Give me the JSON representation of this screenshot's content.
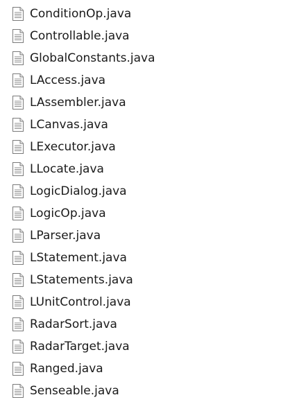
{
  "files": [
    {
      "name": "ConditionOp.java",
      "icon": "document-icon"
    },
    {
      "name": "Controllable.java",
      "icon": "document-icon"
    },
    {
      "name": "GlobalConstants.java",
      "icon": "document-icon"
    },
    {
      "name": "LAccess.java",
      "icon": "document-icon"
    },
    {
      "name": "LAssembler.java",
      "icon": "document-icon"
    },
    {
      "name": "LCanvas.java",
      "icon": "document-icon"
    },
    {
      "name": "LExecutor.java",
      "icon": "document-icon"
    },
    {
      "name": "LLocate.java",
      "icon": "document-icon"
    },
    {
      "name": "LogicDialog.java",
      "icon": "document-icon"
    },
    {
      "name": "LogicOp.java",
      "icon": "document-icon"
    },
    {
      "name": "LParser.java",
      "icon": "document-icon"
    },
    {
      "name": "LStatement.java",
      "icon": "document-icon"
    },
    {
      "name": "LStatements.java",
      "icon": "document-icon"
    },
    {
      "name": "LUnitControl.java",
      "icon": "document-icon"
    },
    {
      "name": "RadarSort.java",
      "icon": "document-icon"
    },
    {
      "name": "RadarTarget.java",
      "icon": "document-icon"
    },
    {
      "name": "Ranged.java",
      "icon": "document-icon"
    },
    {
      "name": "Senseable.java",
      "icon": "document-icon"
    }
  ]
}
